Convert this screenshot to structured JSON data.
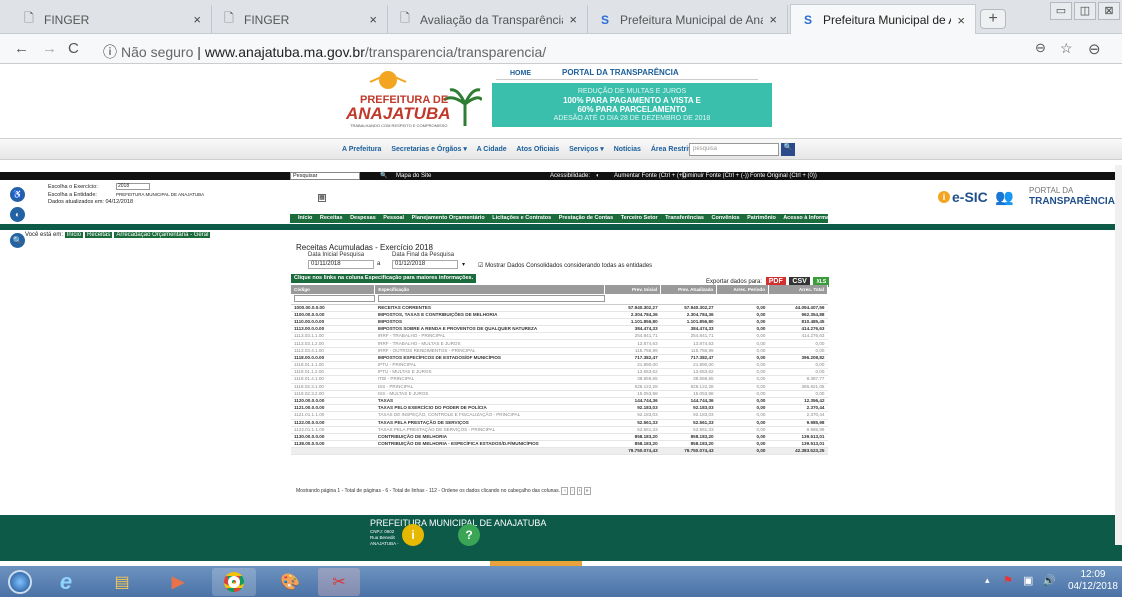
{
  "browser": {
    "tabs": [
      {
        "title": "FINGER",
        "active": false
      },
      {
        "title": "FINGER",
        "active": false
      },
      {
        "title": "Avaliação da Transparência dos",
        "active": false
      },
      {
        "title": "Prefeitura Municipal de Anajatu",
        "active": false
      },
      {
        "title": "Prefeitura Municipal de Anajatu",
        "active": true
      }
    ],
    "url_security": "Não seguro",
    "url_host": "www.anajatuba.ma.gov.br",
    "url_path": "/transparencia/transparencia/"
  },
  "site": {
    "logo_line1": "PREFEITURA DE",
    "logo_line2": "ANAJATUBA",
    "logo_tagline": "TRABALHANDO COM RESPEITO E COMPROMISSO",
    "topnav_home": "HOME",
    "topnav_portal": "PORTAL DA TRANSPARÊNCIA",
    "promo": [
      "REDUÇÃO DE MULTAS E JUROS",
      "100% PARA PAGAMENTO A VISTA E",
      "60% PARA PARCELAMENTO",
      "ADESÃO ATÉ O DIA 28 DE DEZEMBRO DE 2018"
    ],
    "menu": [
      "A Prefeitura",
      "Secretarias e Órgãos ▾",
      "A Cidade",
      "Atos Oficiais",
      "Serviços ▾",
      "Notícias",
      "Área Restrita ▾"
    ],
    "search_placeholder": "pesquisa"
  },
  "portal": {
    "search_label": "Pesquisar",
    "map_label": "Mapa do Site",
    "accessibility": "Acessibilidade:",
    "font_up": "Aumentar Fonte (Ctrl + (+))",
    "font_down": "Diminuir Fonte (Ctrl + (-))",
    "font_orig": "Fonte Original (Ctrl + (0))",
    "exercise_label": "Escolha o Exercício:",
    "exercise_value": "2018",
    "entity_label": "Escolha a Entidade:",
    "entity_value": "PREFEITURA MUNICIPAL DE ANAJATUBA",
    "updated": "Dados atualizados em: 04/12/2018",
    "esic": "e-SIC",
    "portal_line1": "PORTAL DA",
    "portal_line2": "TRANSPARÊNCIA",
    "green_menu": [
      "Início",
      "Receitas",
      "Despesas",
      "Pessoal",
      "Planejamento Orçamentário",
      "Licitações e Contratos",
      "Prestação de Contas",
      "Terceiro Setor",
      "Transferências",
      "Convênios",
      "Patrimônio",
      "Acesso à Informação"
    ],
    "breadcrumb_prefix": "Você está em:",
    "breadcrumb": [
      "Início",
      "Receitas",
      "Arrecadação Orçamentária - Geral"
    ],
    "title": "Receitas Acumuladas - Exercício 2018",
    "date_start_label": "Data Inicial Pesquisa",
    "date_end_label": "Data Final da Pesquisa",
    "date_start": "01/11/2018",
    "date_end": "01/12/2018",
    "consolidated": "Mostrar Dados Consolidados considerando todas as entidades",
    "info_tip": "Clique nos links na coluna Especificação para maiores informações.",
    "export_label": "Exportar dados para:",
    "export_pdf": "PDF",
    "export_csv": "CSV",
    "export_xls": "XLS"
  },
  "table": {
    "headers": [
      "Código",
      "Especificação",
      "Prev. Inicial",
      "Prev. Atualizada",
      "Arrec. Período",
      "Arrec. Total"
    ],
    "rows": [
      {
        "c": "1000.00.0.0.00",
        "e": "RECEITAS CORRENTES",
        "pi": "57.940.302,27",
        "pa": "57.940.302,27",
        "ap": "0,00",
        "at": "44.094.407,59",
        "s": "b"
      },
      {
        "c": "1100.00.0.0.00",
        "e": "IMPOSTOS, TAXAS E CONTRIBUIÇÕES DE MELHORIA",
        "pi": "2.304.784,36",
        "pa": "2.304.784,36",
        "ap": "0,00",
        "at": "962.354,88",
        "s": "b"
      },
      {
        "c": "1110.00.0.0.00",
        "e": "IMPOSTOS",
        "pi": "1.101.856,80",
        "pa": "1.101.856,80",
        "ap": "0,00",
        "at": "810.485,45",
        "s": "b"
      },
      {
        "c": "1113.00.0.0.00",
        "e": "IMPOSTOS SOBRE A RENDA E PROVENTOS DE QUALQUER NATUREZA",
        "pi": "384.474,33",
        "pa": "384.474,33",
        "ap": "0,00",
        "at": "414.276,63",
        "s": "b"
      },
      {
        "c": "1113.03.1.1.00",
        "e": "IRRF - TRABALHO - PRINCIPAL",
        "pi": "254.841,71",
        "pa": "254.841,71",
        "ap": "0,00",
        "at": "414.276,63",
        "s": "n"
      },
      {
        "c": "1113.03.1.2.00",
        "e": "IRRF - TRABALHO - MULTAS E JUROS",
        "pi": "13.874,63",
        "pa": "13.874,63",
        "ap": "0,00",
        "at": "0,00",
        "s": "n"
      },
      {
        "c": "1113.03.4.1.00",
        "e": "IRRF - OUTROS RENDIMENTOS - PRINCIPAL",
        "pi": "115.756,99",
        "pa": "115.756,99",
        "ap": "0,00",
        "at": "0,00",
        "s": "n"
      },
      {
        "c": "1118.00.0.0.00",
        "e": "IMPOSTOS ESPECÍFICOS DE ESTADOS/DF MUNICÍPIOS",
        "pi": "717.382,47",
        "pa": "717.382,47",
        "ap": "0,00",
        "at": "396.208,82",
        "s": "b"
      },
      {
        "c": "1118.01.1.1.00",
        "e": "IPTU - PRINCIPAL",
        "pi": "21.890,00",
        "pa": "21.890,00",
        "ap": "0,00",
        "at": "0,00",
        "s": "n"
      },
      {
        "c": "1118.01.1.2.00",
        "e": "IPTU - MULTAS E JUROS",
        "pi": "13.653,62",
        "pa": "13.653,62",
        "ap": "0,00",
        "at": "0,00",
        "s": "n"
      },
      {
        "c": "1118.01.4.1.00",
        "e": "ITBI - PRINCIPAL",
        "pi": "38.659,65",
        "pa": "38.659,65",
        "ap": "0,00",
        "at": "9.387,77",
        "s": "n"
      },
      {
        "c": "1118.02.3.1.00",
        "e": "ISS - PRINCIPAL",
        "pi": "628.122,28",
        "pa": "628.122,28",
        "ap": "0,00",
        "at": "386.821,05",
        "s": "n"
      },
      {
        "c": "1118.02.3.2.00",
        "e": "ISS - MULTAS E JUROS",
        "pi": "15.053,98",
        "pa": "15.053,98",
        "ap": "0,00",
        "at": "0,00",
        "s": "n"
      },
      {
        "c": "1120.00.0.0.00",
        "e": "TAXAS",
        "pi": "144.744,36",
        "pa": "144.744,36",
        "ap": "0,00",
        "at": "12.356,42",
        "s": "b"
      },
      {
        "c": "1121.00.0.0.00",
        "e": "TAXAS PELO EXERCÍCIO DO PODER DE POLÍCIA",
        "pi": "92.183,03",
        "pa": "92.183,03",
        "ap": "0,00",
        "at": "2.370,44",
        "s": "b"
      },
      {
        "c": "1121.01.1.1.00",
        "e": "TAXAS DE INSPEÇÃO, CONTROLE E FISCALIZAÇÃO - PRINCIPAL",
        "pi": "92.183,03",
        "pa": "92.183,03",
        "ap": "0,00",
        "at": "2.370,44",
        "s": "n"
      },
      {
        "c": "1122.00.0.0.00",
        "e": "TAXAS PELA PRESTAÇÃO DE SERVIÇOS",
        "pi": "52.561,33",
        "pa": "52.561,33",
        "ap": "0,00",
        "at": "9.985,98",
        "s": "b"
      },
      {
        "c": "1122.01.1.1.00",
        "e": "TAXAS PELA PRESTAÇÃO DE SERVIÇOS - PRINCIPAL",
        "pi": "52.561,33",
        "pa": "52.561,33",
        "ap": "0,00",
        "at": "9.985,98",
        "s": "n"
      },
      {
        "c": "1130.00.0.0.00",
        "e": "CONTRIBUIÇÃO DE MELHORIA",
        "pi": "858.183,20",
        "pa": "858.183,20",
        "ap": "0,00",
        "at": "139.513,01",
        "s": "b"
      },
      {
        "c": "1138.00.0.0.00",
        "e": "CONTRIBUIÇÃO DE MELHORIA - ESPECÍFICA ESTADOS/D.F/MUNICÍPIOS",
        "pi": "858.183,20",
        "pa": "858.183,20",
        "ap": "0,00",
        "at": "139.513,01",
        "s": "b"
      }
    ],
    "totals": {
      "pi": "79.750.074,43",
      "pa": "79.750.074,43",
      "ap": "0,00",
      "at": "42.383.523,25"
    }
  },
  "pager": "Mostrando página 1 - Total de páginas - 6 - Total de linhas - 112 - Ordene os dados clicando no cabeçalho das colunas.",
  "footer": {
    "title": "PREFEITURA MUNICIPAL DE ANAJATUBA",
    "lines": [
      "CNPJ: 0602",
      "Rua Benedit",
      "ANAJATUBA -"
    ]
  },
  "taskbar": {
    "time": "12:09",
    "date": "04/12/2018"
  },
  "colors": {
    "green": "#1c6b3c",
    "teal": "#0d5a49",
    "promo": "#3bbfad"
  }
}
